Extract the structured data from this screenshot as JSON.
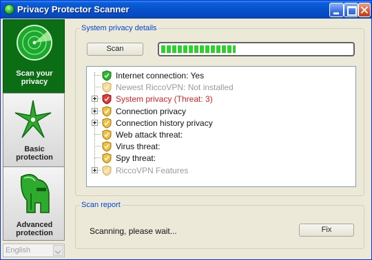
{
  "window": {
    "title": "Privacy Protector Scanner"
  },
  "sidebar": {
    "items": [
      {
        "label_line1": "Scan your",
        "label_line2": "privacy",
        "icon": "radar-icon",
        "active": true
      },
      {
        "label_line1": "Basic",
        "label_line2": "protection",
        "icon": "shuriken-icon",
        "active": false
      },
      {
        "label_line1": "Advanced",
        "label_line2": "protection",
        "icon": "helmet-icon",
        "active": false
      }
    ],
    "language": "English"
  },
  "details": {
    "legend": "System privacy details",
    "scan_label": "Scan",
    "progress_fraction": 0.39,
    "tree": [
      {
        "text": "Internet connection: Yes",
        "shield": "green",
        "style": "normal",
        "expandable": false
      },
      {
        "text": "Newest RiccoVPN: Not installed",
        "shield": "faded",
        "style": "gray",
        "expandable": false
      },
      {
        "text": "System privacy (Threat: 3)",
        "shield": "red",
        "style": "red",
        "expandable": true
      },
      {
        "text": "Connection privacy",
        "shield": "yellow",
        "style": "normal",
        "expandable": true
      },
      {
        "text": "Connection history privacy",
        "shield": "yellow",
        "style": "normal",
        "expandable": true
      },
      {
        "text": "Web attack threat:",
        "shield": "yellow",
        "style": "normal",
        "expandable": false
      },
      {
        "text": "Virus threat:",
        "shield": "yellow",
        "style": "normal",
        "expandable": false
      },
      {
        "text": "Spy threat:",
        "shield": "yellow",
        "style": "normal",
        "expandable": false
      },
      {
        "text": "RiccoVPN Features",
        "shield": "faded",
        "style": "gray",
        "expandable": true
      }
    ]
  },
  "report": {
    "legend": "Scan report",
    "status": "Scanning, please wait...",
    "fix_label": "Fix"
  },
  "colors": {
    "active_nav_bg": "#0b6e14",
    "legend_text": "#0046d5",
    "threat_red": "#e02020",
    "progress_green": "#2fd02f"
  }
}
